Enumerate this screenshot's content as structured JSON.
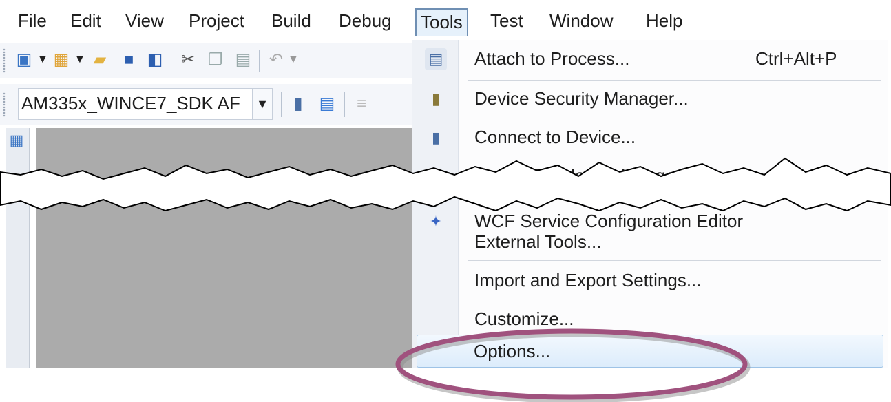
{
  "menubar": {
    "items": [
      {
        "label": "File"
      },
      {
        "label": "Edit"
      },
      {
        "label": "View"
      },
      {
        "label": "Project"
      },
      {
        "label": "Build"
      },
      {
        "label": "Debug"
      },
      {
        "label": "Tools"
      },
      {
        "label": "Test"
      },
      {
        "label": "Window"
      },
      {
        "label": "Help"
      }
    ],
    "active": "Tools"
  },
  "toolbar": {
    "config_combo_value": "AM335x_WINCE7_SDK AF"
  },
  "tools_menu": {
    "items": [
      {
        "label": "Attach to Process...",
        "shortcut": "Ctrl+Alt+P",
        "icon": "attach-process-icon"
      },
      {
        "label": "Device Security Manager...",
        "icon": "device-security-icon"
      },
      {
        "label": "Connect to Device...",
        "icon": "connect-device-icon"
      },
      {
        "label": "Device Emulator Manager...",
        "icon": "emulator-manager-icon"
      },
      {
        "label": "WCF Service Configuration Editor",
        "icon": "wcf-config-icon"
      },
      {
        "label": "External Tools..."
      },
      {
        "label": "Import and Export Settings..."
      },
      {
        "label": "Customize..."
      },
      {
        "label": "Options..."
      }
    ],
    "highlighted": "Options..."
  },
  "colors": {
    "highlight_ellipse": "#a0527e",
    "menu_active_border": "#6f8fb3",
    "editor_background": "#ababab"
  }
}
